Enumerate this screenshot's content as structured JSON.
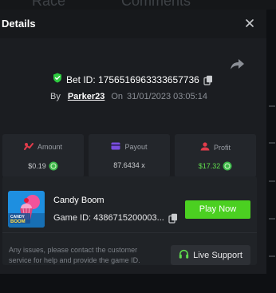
{
  "background": {
    "tabs": [
      "Race",
      "Comments"
    ]
  },
  "modal": {
    "title": "Details",
    "close_icon": "close-icon",
    "share_icon": "share-arrow-icon"
  },
  "bet": {
    "label": "Bet ID: 1756516963333657736",
    "by_label": "By",
    "username": "Parker23",
    "on_label": "On",
    "date": "31/01/2023 03:05:14"
  },
  "stats": [
    {
      "label": "Amount",
      "value": "$0.19",
      "icon": "amount-icon",
      "has_coin": true
    },
    {
      "label": "Payout",
      "value": "87.6434 x",
      "icon": "payout-icon",
      "has_coin": false
    },
    {
      "label": "Profit",
      "value": "$17.32",
      "icon": "profit-icon",
      "has_coin": true
    }
  ],
  "game": {
    "name": "Candy Boom",
    "id_label": "Game ID: 4386715200003...",
    "thumbnail_text": "CANDY BOOM",
    "play_label": "Play Now"
  },
  "support": {
    "notice": "Any issues, please contact the customer service for help and provide the game ID.",
    "button_label": "Live Support"
  },
  "colors": {
    "accent_green": "#4bd021",
    "profit_green": "#5fdd4d",
    "shield_green": "#2ecc40",
    "stat_icon_red": "#e23c4b",
    "payout_icon_purple": "#7a4ee0"
  }
}
